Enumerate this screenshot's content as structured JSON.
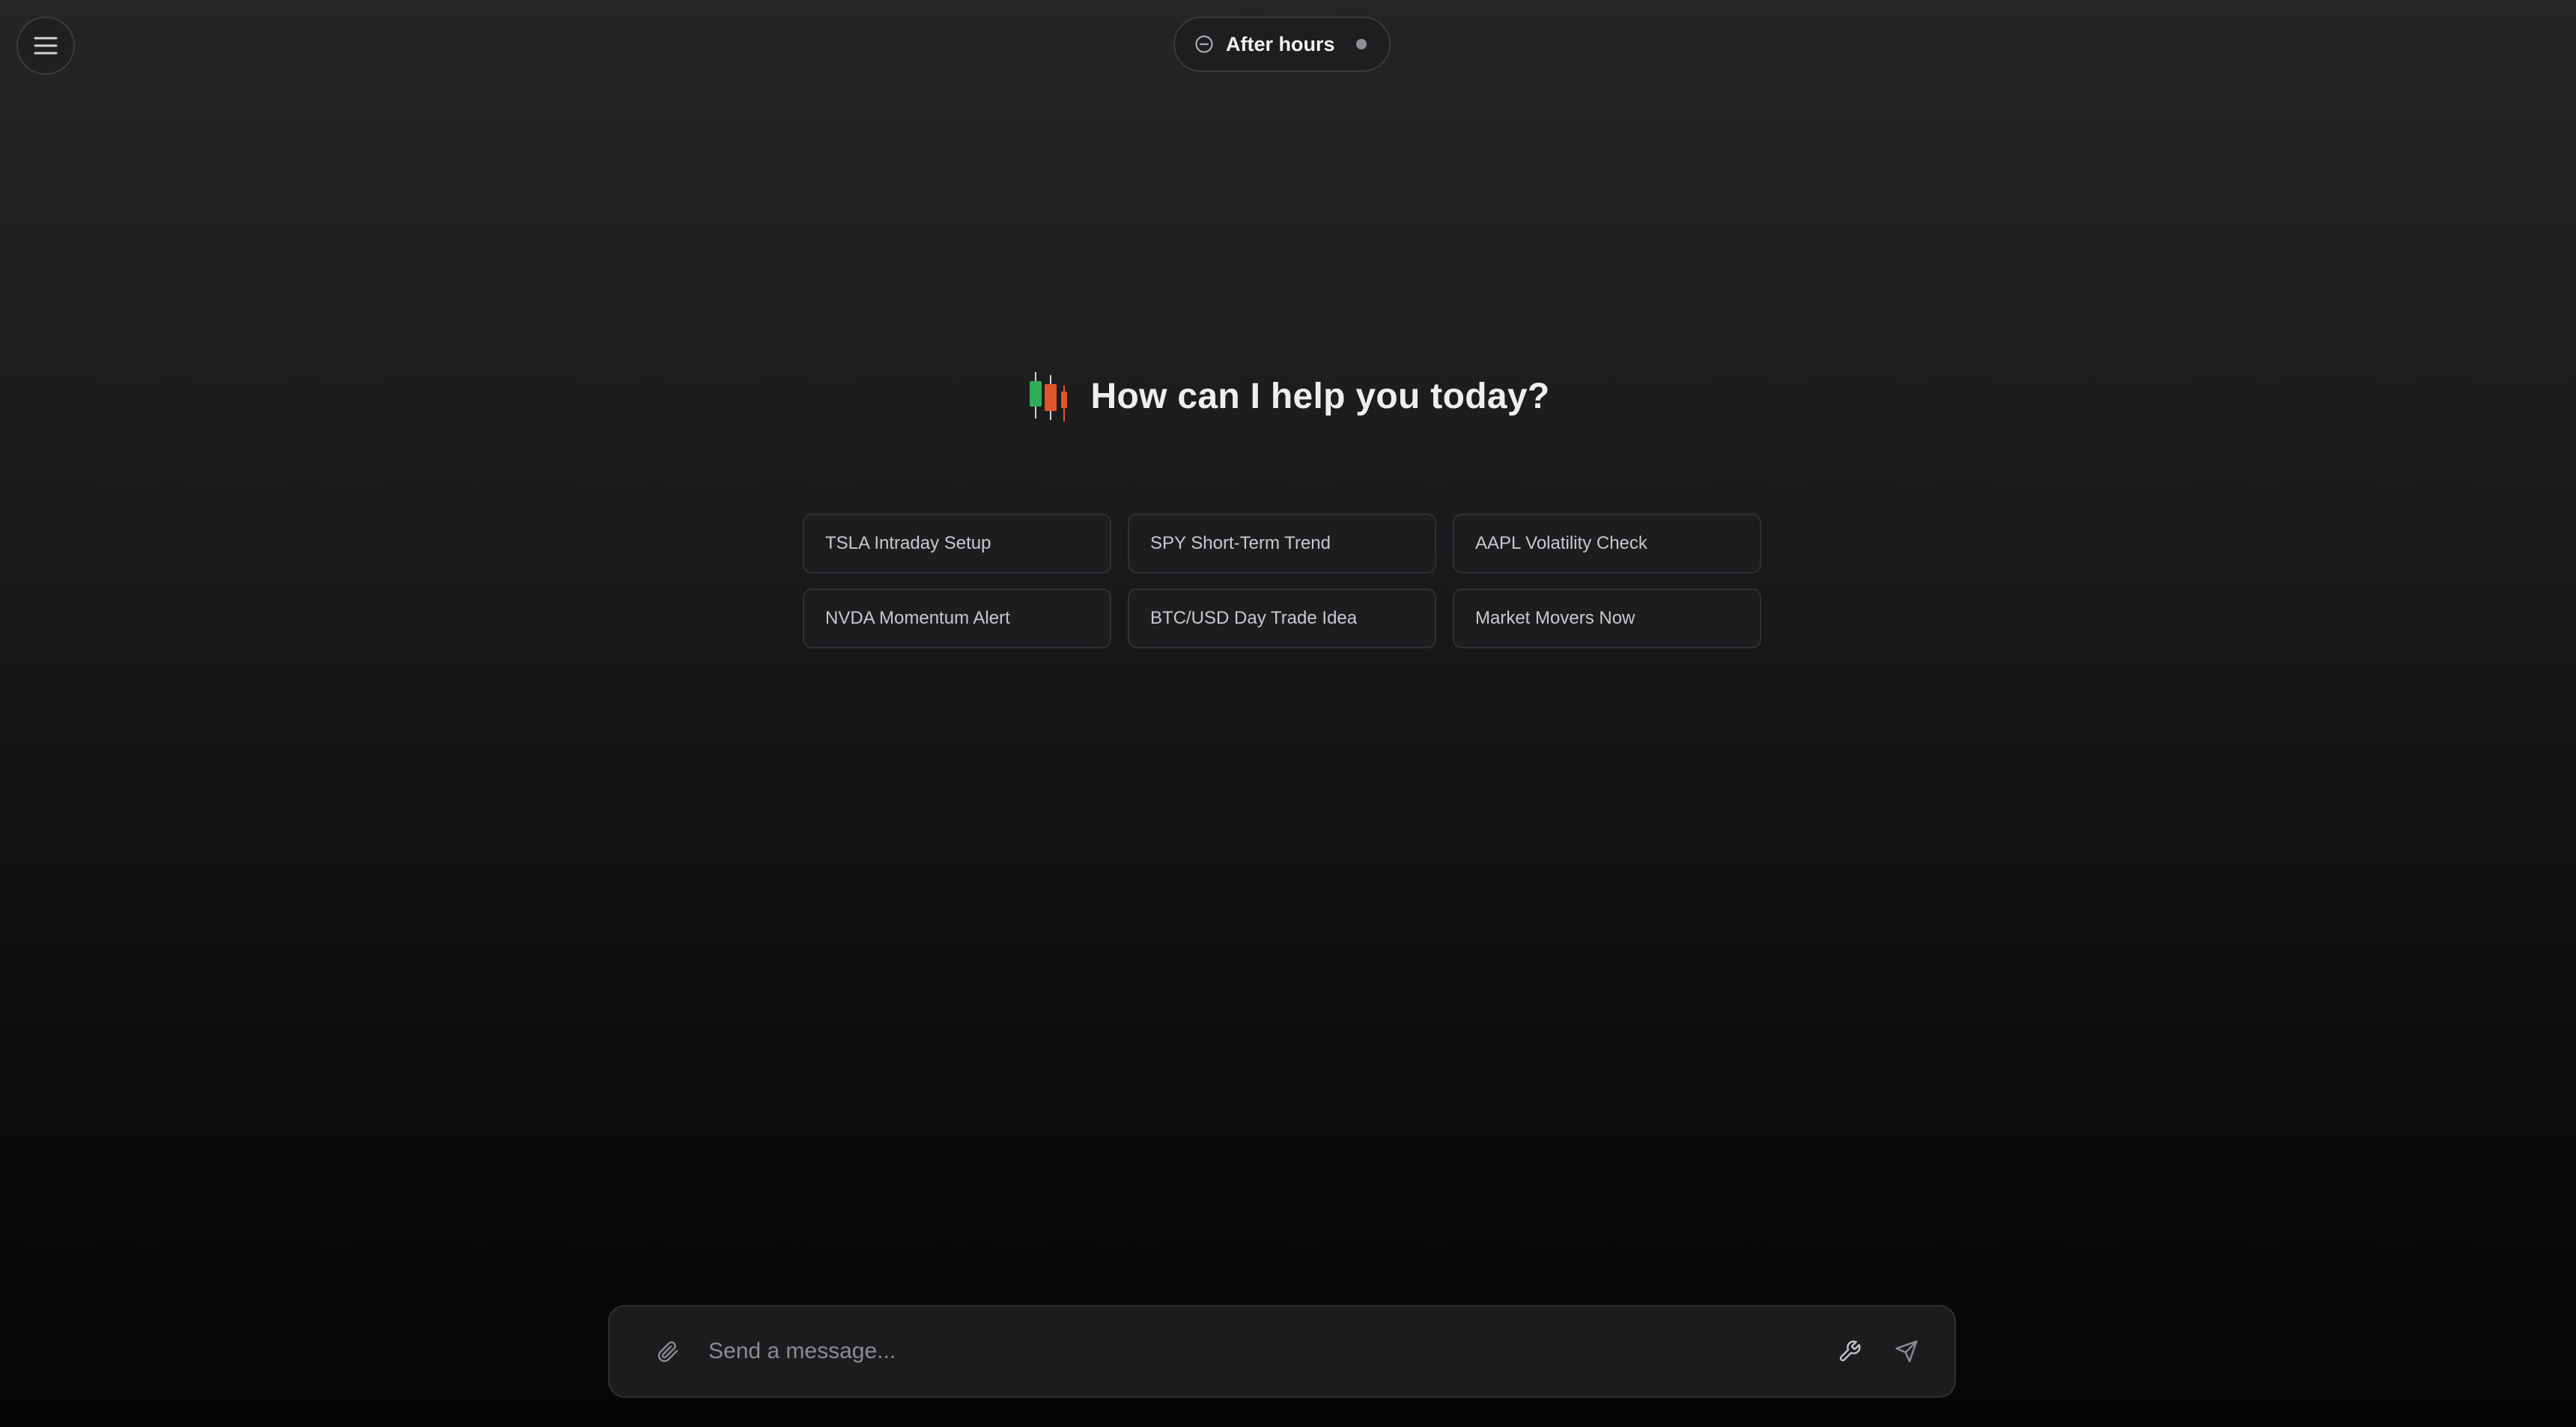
{
  "header": {
    "menu_icon": "hamburger-menu-icon",
    "status": {
      "label": "After hours",
      "icon": "minus-circle-icon",
      "dot_color": "#8e8f94"
    }
  },
  "hero": {
    "logo_icon": "candlestick-chart-icon",
    "title": "How can I help you today?"
  },
  "suggestions": [
    {
      "label": "TSLA Intraday Setup"
    },
    {
      "label": "SPY Short-Term Trend"
    },
    {
      "label": "AAPL Volatility Check"
    },
    {
      "label": "NVDA Momentum Alert"
    },
    {
      "label": "BTC/USD Day Trade Idea"
    },
    {
      "label": "Market Movers Now"
    }
  ],
  "composer": {
    "placeholder": "Send a message...",
    "value": "",
    "attach_icon": "paperclip-icon",
    "tools_icon": "wrench-icon",
    "send_icon": "send-icon"
  },
  "colors": {
    "candle_green": "#2fae5a",
    "candle_red": "#e0562c"
  }
}
